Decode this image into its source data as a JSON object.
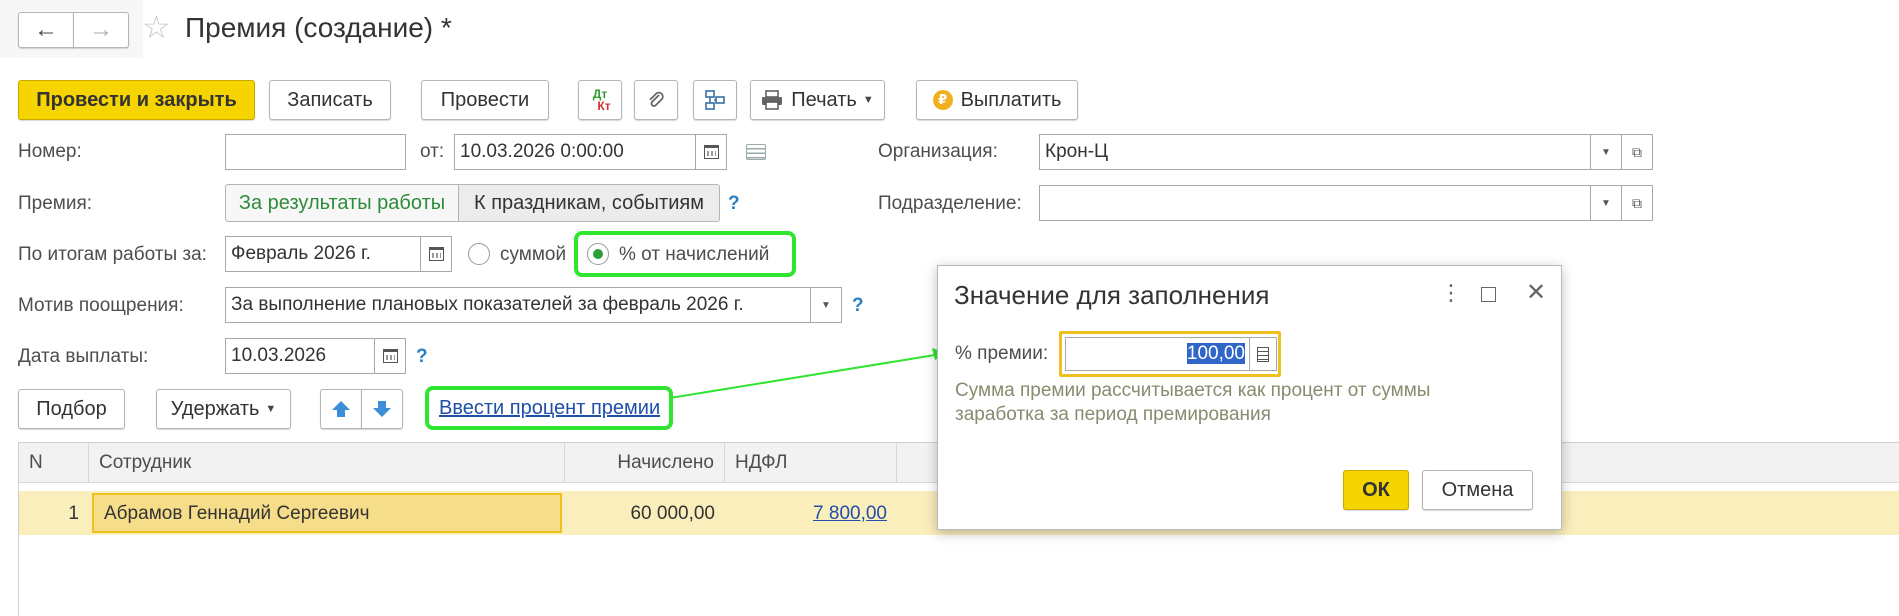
{
  "window": {
    "title": "Премия (создание) *"
  },
  "nav": {
    "back": "←",
    "forward": "→",
    "star": "☆"
  },
  "toolbar": {
    "post_close": "Провести и закрыть",
    "save": "Записать",
    "post": "Провести",
    "dt": "Дт",
    "kt": "Кт",
    "print": "Печать",
    "pay": "Выплатить"
  },
  "form": {
    "number_label": "Номер:",
    "number_value": "",
    "from_label": "от:",
    "date_value": "10.03.2026  0:00:00",
    "org_label": "Организация:",
    "org_value": "Крон-Ц",
    "bonus_label": "Премия:",
    "bonus_tab_results": "За результаты работы",
    "bonus_tab_holidays": "К праздникам, событиям",
    "subdivision_label": "Подразделение:",
    "subdivision_value": "",
    "period_label": "По итогам работы за:",
    "period_value": "Февраль 2026 г.",
    "radio_sum": "суммой",
    "radio_percent": "% от начислений",
    "motive_label": "Мотив поощрения:",
    "motive_value": "За выполнение плановых показателей за февраль 2026 г.",
    "paydate_label": "Дата выплаты:",
    "paydate_value": "10.03.2026",
    "help": "?"
  },
  "table_toolbar": {
    "select": "Подбор",
    "hold": "Удержать",
    "enter_percent_link": "Ввести процент премии"
  },
  "table": {
    "headers": [
      "N",
      "Сотрудник",
      "Начислено",
      "НДФЛ"
    ],
    "rows": [
      {
        "n": "1",
        "employee": "Абрамов Геннадий Сергеевич",
        "accrued": "60 000,00",
        "ndfl": "7 800,00"
      }
    ]
  },
  "dialog": {
    "title": "Значение для заполнения",
    "field_label": "% премии:",
    "field_value": "100,00",
    "hint_line1": "Сумма премии рассчитывается как процент от суммы",
    "hint_line2": "заработка за период премирования",
    "ok": "ОК",
    "cancel": "Отмена"
  },
  "colors": {
    "accent_yellow": "#f5d400",
    "highlight_green": "#2fe52f",
    "link_blue": "#1f4fa8",
    "row_highlight": "#faeebc"
  }
}
